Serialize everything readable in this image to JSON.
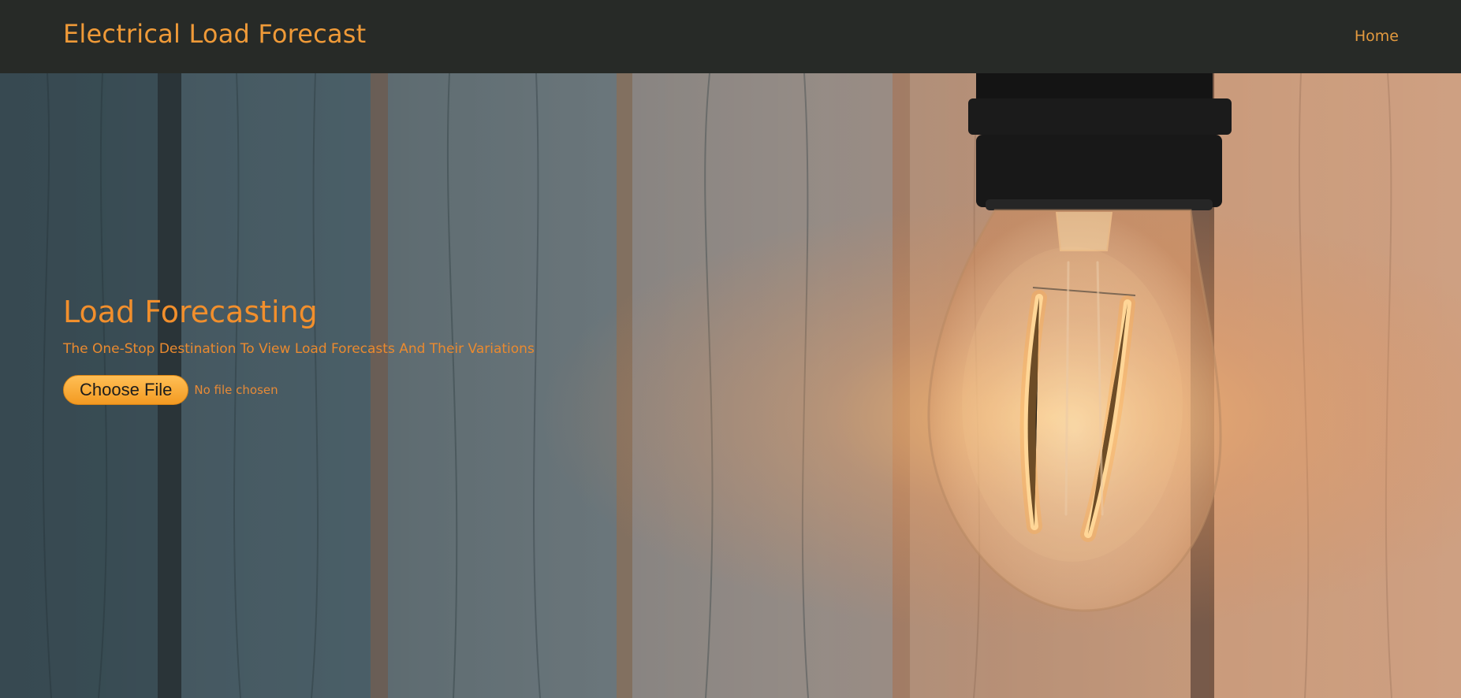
{
  "navbar": {
    "brand": "Electrical Load Forecast",
    "home_link": "Home"
  },
  "hero": {
    "title": "Load Forecasting",
    "subtitle": "The One-Stop Destination To View Load Forecasts And Their Variations",
    "file_input": {
      "button_label": "Choose File",
      "status_text": "No file chosen"
    }
  },
  "colors": {
    "navbar_bg": "#272a27",
    "accent": "#f28f2c",
    "button_orange": "#f7a93a"
  },
  "icons": {
    "background_image": "light-bulb-on-wooden-wall-photo"
  }
}
